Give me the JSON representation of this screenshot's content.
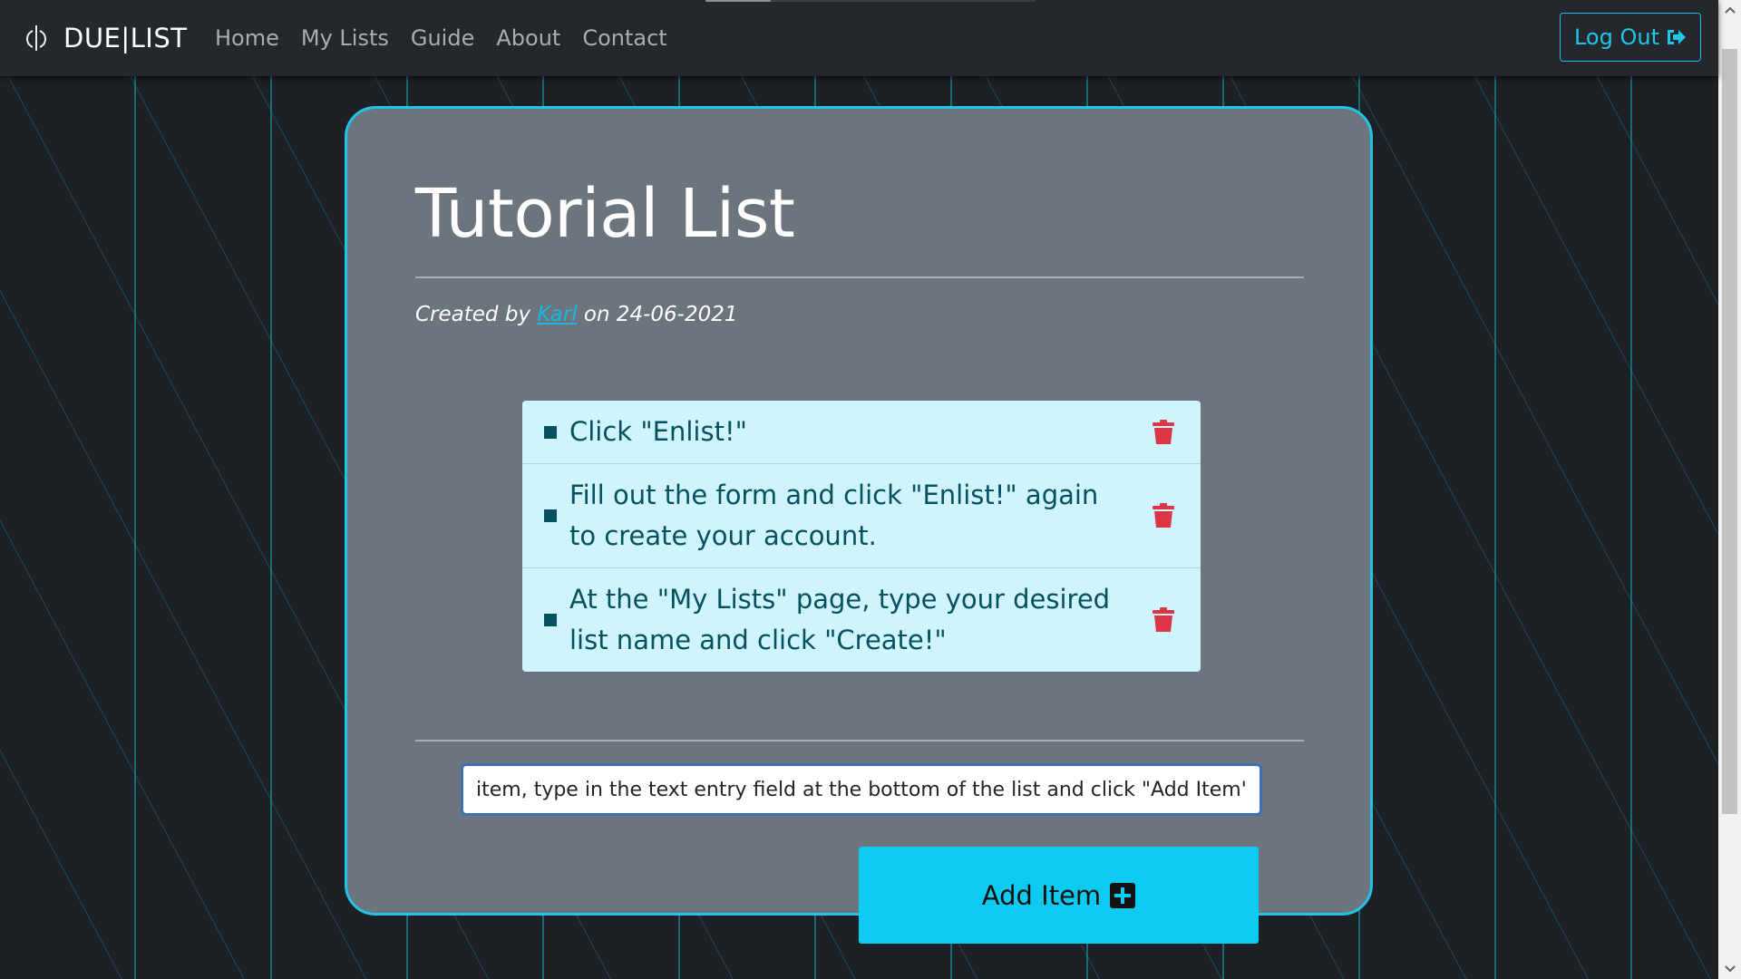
{
  "nav": {
    "brand": "DUE|LIST",
    "links": [
      "Home",
      "My Lists",
      "Guide",
      "About",
      "Contact"
    ],
    "logout_label": "Log Out"
  },
  "list": {
    "title": "Tutorial List",
    "created_prefix": "Created by",
    "author": "Karl",
    "created_suffix": "on 24-06-2021",
    "items": [
      "Click \"Enlist!\"",
      "Fill out the form and click \"Enlist!\" again to create your account.",
      "At the \"My Lists\" page, type your desired list name and click \"Create!\""
    ]
  },
  "input": {
    "value": "item, type in the text entry field at the bottom of the list and click \"Add Item\"."
  },
  "add_button_label": "Add Item",
  "colors": {
    "accent": "#0dcaf0",
    "card": "#6c757d",
    "list_bg": "#cff4fc",
    "delete": "#dc3545"
  }
}
